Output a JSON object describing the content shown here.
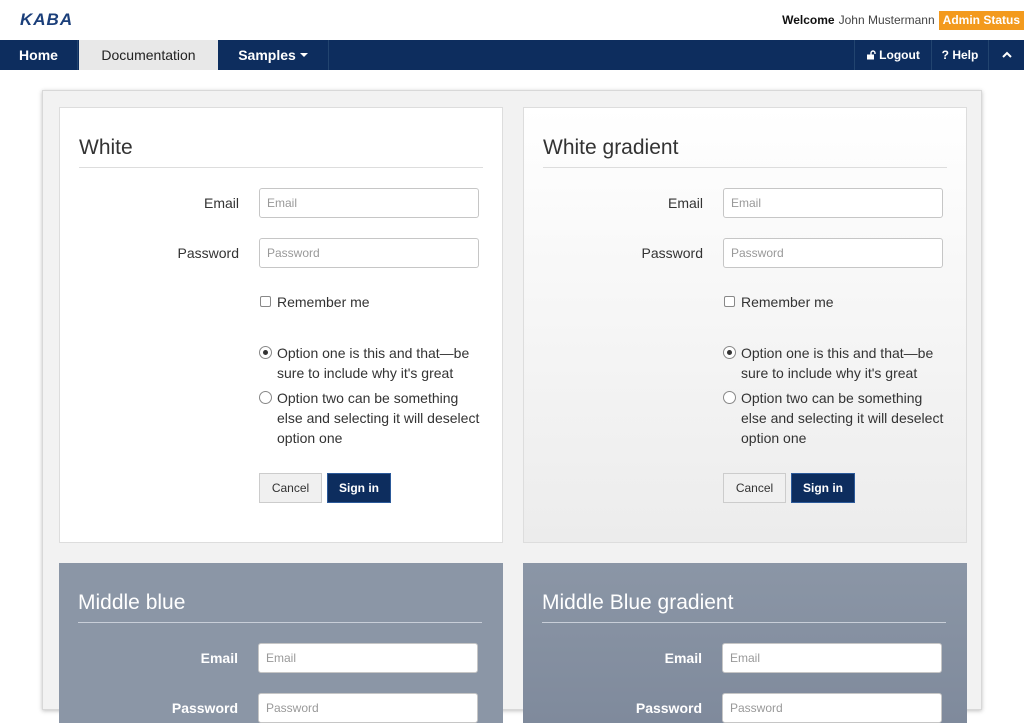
{
  "header": {
    "logo_text": "KABA",
    "welcome_label": "Welcome",
    "user_name": "John Mustermann",
    "status_badge": "Admin Status"
  },
  "nav": {
    "home": "Home",
    "documentation": "Documentation",
    "samples": "Samples",
    "logout": "Logout",
    "help": "Help"
  },
  "form": {
    "email_label": "Email",
    "email_placeholder": "Email",
    "password_label": "Password",
    "password_placeholder": "Password",
    "remember_label": "Remember me",
    "option_one": "Option one is this and that—be sure to include why it's great",
    "option_two": "Option two can be something else and selecting it will deselect option one",
    "cancel": "Cancel",
    "sign_in": "Sign in"
  },
  "panels": [
    {
      "title": "White"
    },
    {
      "title": "White gradient"
    },
    {
      "title": "Middle blue"
    },
    {
      "title": "Middle Blue gradient"
    }
  ],
  "colors": {
    "nav_bg": "#0d2d5e",
    "badge": "#f39a1d",
    "middle_blue": "#8b96a6"
  }
}
